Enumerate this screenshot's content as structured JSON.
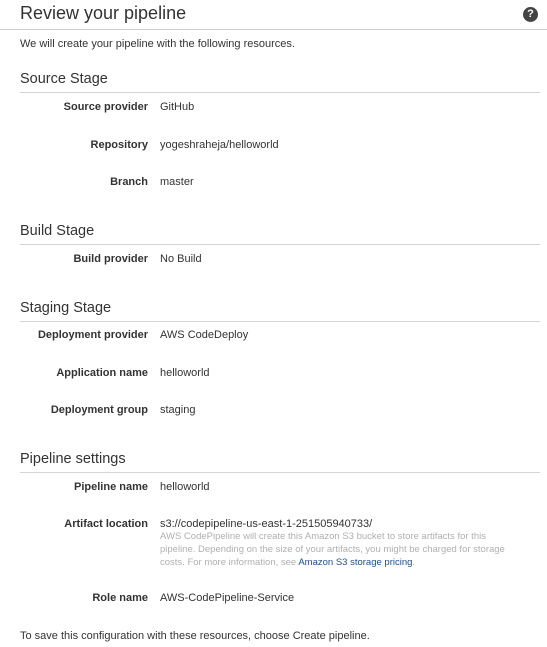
{
  "header": {
    "title": "Review your pipeline",
    "help_icon": "question-circle-icon",
    "help_glyph": "?"
  },
  "intro": "We will create your pipeline with the following resources.",
  "source_stage": {
    "title": "Source Stage",
    "fields": [
      {
        "label": "Source provider",
        "value": "GitHub"
      },
      {
        "label": "Repository",
        "value": "yogeshraheja/helloworld"
      },
      {
        "label": "Branch",
        "value": "master"
      }
    ]
  },
  "build_stage": {
    "title": "Build Stage",
    "fields": [
      {
        "label": "Build provider",
        "value": "No Build"
      }
    ]
  },
  "staging_stage": {
    "title": "Staging Stage",
    "fields": [
      {
        "label": "Deployment provider",
        "value": "AWS CodeDeploy"
      },
      {
        "label": "Application name",
        "value": "helloworld"
      },
      {
        "label": "Deployment group",
        "value": "staging"
      }
    ]
  },
  "pipeline_settings": {
    "title": "Pipeline settings",
    "pipeline_name": {
      "label": "Pipeline name",
      "value": "helloworld"
    },
    "artifact_location": {
      "label": "Artifact location",
      "value": "s3://codepipeline-us-east-1-251505940733/",
      "help_text": "AWS CodePipeline will create this Amazon S3 bucket to store artifacts for this pipeline. Depending on the size of your artifacts, you might be charged for storage costs. For more information, see ",
      "help_link": "Amazon S3 storage pricing",
      "help_end": "."
    },
    "role_name": {
      "label": "Role name",
      "value": "AWS-CodePipeline-Service"
    }
  },
  "footer_note": "To save this configuration with these resources, choose Create pipeline.",
  "colors": {
    "text": "#333333",
    "rule": "#d4d4d4",
    "muted": "#b0b0b0",
    "link": "#1a4e94"
  }
}
